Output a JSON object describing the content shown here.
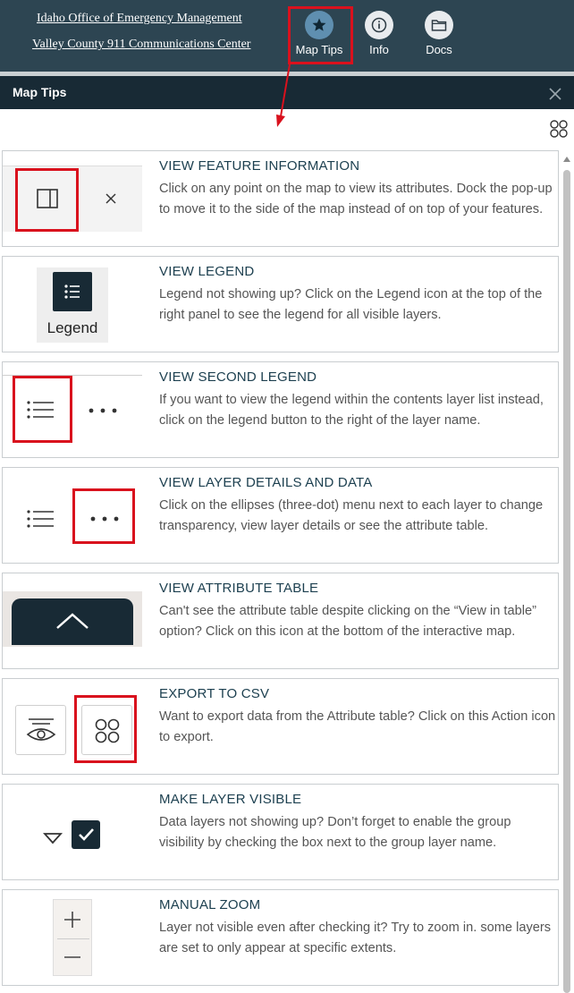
{
  "header": {
    "link1": "Idaho Office of Emergency Management",
    "link2": "Valley County 911 Communications Center",
    "buttons": [
      {
        "label": "Map Tips",
        "icon": "star-icon"
      },
      {
        "label": "Info",
        "icon": "info-icon"
      },
      {
        "label": "Docs",
        "icon": "folder-icon"
      }
    ]
  },
  "panel": {
    "title": "Map Tips"
  },
  "tips": [
    {
      "title": "VIEW FEATURE INFORMATION",
      "desc": "Click on any point on the map to view its attributes. Dock the pop-up to move it to the side of the map instead of on top of your features."
    },
    {
      "title": "VIEW LEGEND",
      "desc": "Legend not showing up? Click on the Legend icon at the top of the right panel to see the legend for all visible layers.",
      "thumb_label": "Legend"
    },
    {
      "title": "VIEW SECOND LEGEND",
      "desc": "If you want to view the legend within the contents layer list instead, click on the legend button to the right of the layer name."
    },
    {
      "title": "VIEW LAYER DETAILS AND DATA",
      "desc": "Click on the ellipses (three-dot) menu next to each layer to change transparency, view layer details or see the attribute table."
    },
    {
      "title": "VIEW ATTRIBUTE TABLE",
      "desc": "Can't see the attribute table despite clicking on the “View in table” option? Click on this icon at the bottom of the interactive map."
    },
    {
      "title": "EXPORT TO CSV",
      "desc": "Want to export data from the Attribute table? Click on this Action icon to export."
    },
    {
      "title": "MAKE LAYER VISIBLE",
      "desc": "Data layers not showing up? Don’t forget to enable the group visibility by checking the box next to the group layer name."
    },
    {
      "title": "MANUAL ZOOM",
      "desc": "Layer not visible even after checking it? Try to zoom in. some layers are set to only appear at specific extents."
    }
  ],
  "colors": {
    "header_bg": "#2d4552",
    "panel_bar_bg": "#182a35",
    "highlight": "#d9111d",
    "title_text": "#1d4050"
  }
}
